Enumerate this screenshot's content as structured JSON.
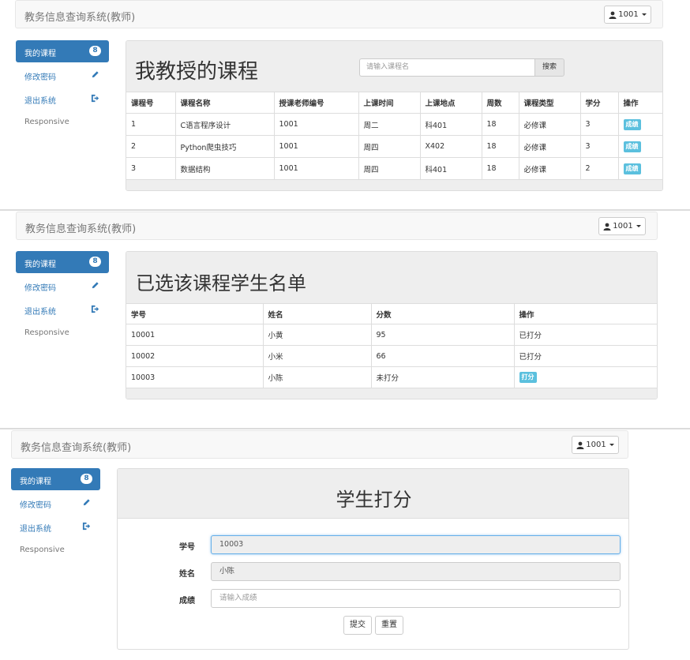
{
  "app": {
    "brand": "教务信息查询系统(教师)",
    "user": "1001"
  },
  "sidebar": {
    "items": [
      {
        "label": "我的课程",
        "badge": "8"
      },
      {
        "label": "修改密码"
      },
      {
        "label": "退出系统"
      },
      {
        "label": "Responsive"
      }
    ]
  },
  "courses_view": {
    "title": "我教授的课程",
    "search_placeholder": "请输入课程名",
    "search_button": "搜索",
    "headers": [
      "课程号",
      "课程名称",
      "授课老师编号",
      "上课时间",
      "上课地点",
      "周数",
      "课程类型",
      "学分",
      "操作"
    ],
    "rows": [
      [
        "1",
        "C语言程序设计",
        "1001",
        "周二",
        "科401",
        "18",
        "必修课",
        "3",
        "成绩"
      ],
      [
        "2",
        "Python爬虫技巧",
        "1001",
        "周四",
        "X402",
        "18",
        "必修课",
        "3",
        "成绩"
      ],
      [
        "3",
        "数据结构",
        "1001",
        "周四",
        "科401",
        "18",
        "必修课",
        "2",
        "成绩"
      ]
    ]
  },
  "students_view": {
    "title": "已选该课程学生名单",
    "headers": [
      "学号",
      "姓名",
      "分数",
      "操作"
    ],
    "rows": [
      {
        "id": "10001",
        "name": "小黄",
        "score": "95",
        "action": "已打分"
      },
      {
        "id": "10002",
        "name": "小米",
        "score": "66",
        "action": "已打分"
      },
      {
        "id": "10003",
        "name": "小陈",
        "score": "未打分",
        "action": "打分"
      }
    ]
  },
  "grade_view": {
    "title": "学生打分",
    "fields": [
      {
        "label": "学号",
        "value": "10003"
      },
      {
        "label": "姓名",
        "value": "小陈"
      },
      {
        "label": "成绩",
        "placeholder": "请输入成绩"
      }
    ],
    "submit": "提交",
    "reset": "重置"
  },
  "colors": {
    "primary": "#337ab7",
    "info": "#5bc0de",
    "jumbotron": "#eeeeee"
  }
}
